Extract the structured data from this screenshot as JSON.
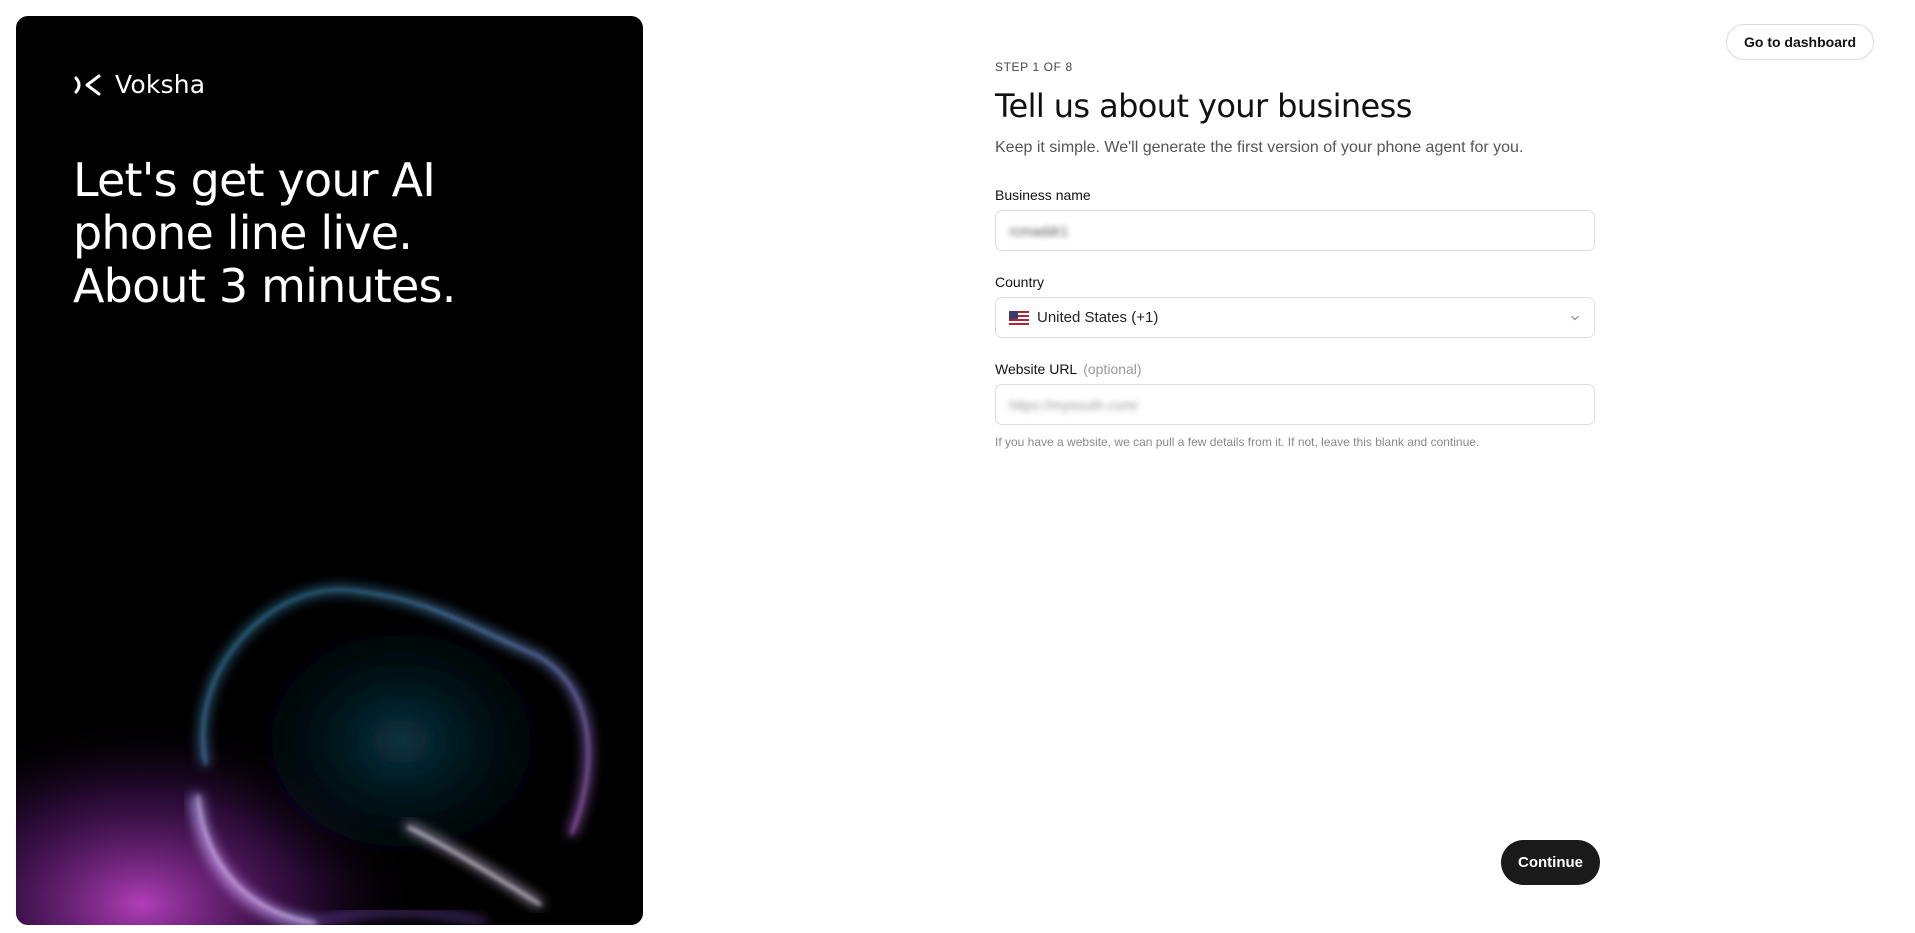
{
  "brand": {
    "name": "Voksha",
    "logo_icon": "voksha-logo-icon"
  },
  "hero": {
    "headline_lines": [
      "Let's get your AI",
      "phone line live.",
      "About 3 minutes."
    ]
  },
  "header": {
    "dashboard_button": "Go to dashboard"
  },
  "form": {
    "step": "STEP 1 OF 8",
    "title": "Tell us about your business",
    "subtitle": "Keep it simple. We'll generate the first version of your phone agent for you.",
    "business_name": {
      "label": "Business name",
      "value": "rcmaddr1"
    },
    "country": {
      "label": "Country",
      "value": "United States (+1)",
      "flag_icon": "us-flag-icon"
    },
    "website": {
      "label": "Website URL",
      "optional": "(optional)",
      "placeholder": "https://mysouth.com/",
      "hint": "If you have a website, we can pull a few details from it. If not, leave this blank and continue."
    },
    "continue_button": "Continue"
  },
  "colors": {
    "hero_bg": "#000000",
    "primary_button": "#1a1a1a",
    "accent_purple": "#c060ff",
    "accent_teal": "#1e6a8a"
  }
}
